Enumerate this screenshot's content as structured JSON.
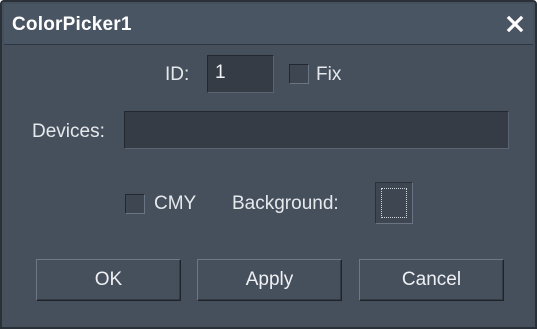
{
  "window": {
    "title": "ColorPicker1",
    "close_glyph": "✕"
  },
  "form": {
    "id_label": "ID:",
    "id_value": "1",
    "fix_label": "Fix",
    "fix_checked": false,
    "devices_label": "Devices:",
    "devices_value": "",
    "cmy_label": "CMY",
    "cmy_checked": false,
    "background_label": "Background:"
  },
  "buttons": {
    "ok": "OK",
    "apply": "Apply",
    "cancel": "Cancel"
  },
  "colors": {
    "dialog_bg": "#46505d",
    "field_bg": "#353c46",
    "text": "#e6e9ec"
  }
}
